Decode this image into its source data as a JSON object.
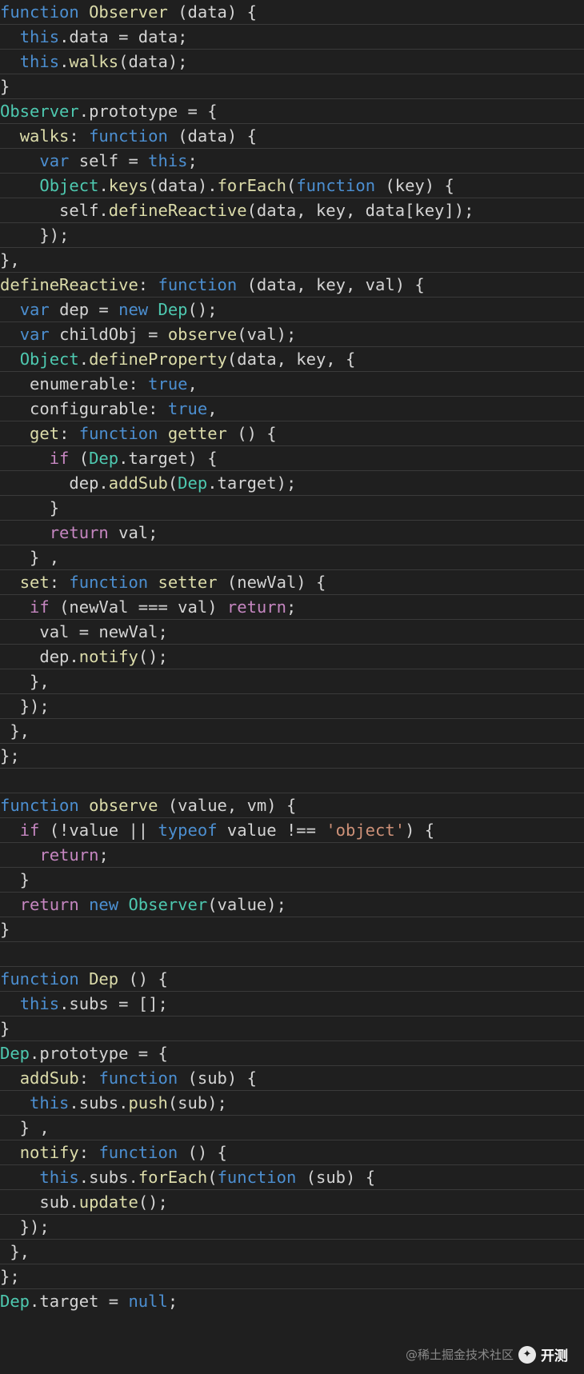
{
  "editor": {
    "colors": {
      "background": "#1f1f1f",
      "keyword": "#4c8fd1",
      "control": "#c586c0",
      "function": "#dcdcaa",
      "class": "#4ec9b0",
      "property": "#9cdcfe",
      "string": "#ce9178",
      "plain": "#d4d4d4"
    },
    "lines": [
      [
        [
          "function ",
          "kw"
        ],
        [
          "Observer ",
          "fn"
        ],
        [
          "(data) {",
          "p"
        ]
      ],
      [
        [
          "  ",
          "p"
        ],
        [
          "this",
          "kw"
        ],
        [
          ".data = data;",
          "p"
        ]
      ],
      [
        [
          "  ",
          "p"
        ],
        [
          "this",
          "kw"
        ],
        [
          ".",
          "p"
        ],
        [
          "walks",
          "fn"
        ],
        [
          "(data);",
          "p"
        ]
      ],
      [
        [
          "}",
          "p"
        ]
      ],
      [
        [
          "Observer",
          "cls"
        ],
        [
          ".prototype = {",
          "p"
        ]
      ],
      [
        [
          "  ",
          "p"
        ],
        [
          "walks",
          "fn"
        ],
        [
          ": ",
          "p"
        ],
        [
          "function ",
          "kw"
        ],
        [
          "(data) {",
          "p"
        ]
      ],
      [
        [
          "    ",
          "p"
        ],
        [
          "var ",
          "kw"
        ],
        [
          "self = ",
          "p"
        ],
        [
          "this",
          "kw"
        ],
        [
          ";",
          "p"
        ]
      ],
      [
        [
          "    ",
          "p"
        ],
        [
          "Object",
          "cls"
        ],
        [
          ".",
          "p"
        ],
        [
          "keys",
          "fn"
        ],
        [
          "(data).",
          "p"
        ],
        [
          "forEach",
          "fn"
        ],
        [
          "(",
          "p"
        ],
        [
          "function ",
          "kw"
        ],
        [
          "(key) {",
          "p"
        ]
      ],
      [
        [
          "      self.",
          "p"
        ],
        [
          "defineReactive",
          "fn"
        ],
        [
          "(data, key, data[key]);",
          "p"
        ]
      ],
      [
        [
          "    });",
          "p"
        ]
      ],
      [
        [
          "},",
          "p"
        ]
      ],
      [
        [
          "defineReactive",
          "fn"
        ],
        [
          ": ",
          "p"
        ],
        [
          "function ",
          "kw"
        ],
        [
          "(data, key, val) {",
          "p"
        ]
      ],
      [
        [
          "  ",
          "p"
        ],
        [
          "var ",
          "kw"
        ],
        [
          "dep = ",
          "p"
        ],
        [
          "new ",
          "kw"
        ],
        [
          "Dep",
          "cls"
        ],
        [
          "();",
          "p"
        ]
      ],
      [
        [
          "  ",
          "p"
        ],
        [
          "var ",
          "kw"
        ],
        [
          "childObj = ",
          "p"
        ],
        [
          "observe",
          "fn"
        ],
        [
          "(val);",
          "p"
        ]
      ],
      [
        [
          "  ",
          "p"
        ],
        [
          "Object",
          "cls"
        ],
        [
          ".",
          "p"
        ],
        [
          "defineProperty",
          "fn"
        ],
        [
          "(data, key, {",
          "p"
        ]
      ],
      [
        [
          "   enumerable: ",
          "p"
        ],
        [
          "true",
          "kw"
        ],
        [
          ",",
          "p"
        ]
      ],
      [
        [
          "   configurable: ",
          "p"
        ],
        [
          "true",
          "kw"
        ],
        [
          ",",
          "p"
        ]
      ],
      [
        [
          "   ",
          "p"
        ],
        [
          "get",
          "fn"
        ],
        [
          ": ",
          "p"
        ],
        [
          "function ",
          "kw"
        ],
        [
          "getter ",
          "fn"
        ],
        [
          "() {",
          "p"
        ]
      ],
      [
        [
          "     ",
          "p"
        ],
        [
          "if ",
          "kw2"
        ],
        [
          "(",
          "p"
        ],
        [
          "Dep",
          "cls"
        ],
        [
          ".target) {",
          "p"
        ]
      ],
      [
        [
          "       dep.",
          "p"
        ],
        [
          "addSub",
          "fn"
        ],
        [
          "(",
          "p"
        ],
        [
          "Dep",
          "cls"
        ],
        [
          ".target);",
          "p"
        ]
      ],
      [
        [
          "     }",
          "p"
        ]
      ],
      [
        [
          "     ",
          "p"
        ],
        [
          "return ",
          "kw2"
        ],
        [
          "val;",
          "p"
        ]
      ],
      [
        [
          "   } ,",
          "p"
        ]
      ],
      [
        [
          "  ",
          "p"
        ],
        [
          "set",
          "fn"
        ],
        [
          ": ",
          "p"
        ],
        [
          "function ",
          "kw"
        ],
        [
          "setter ",
          "fn"
        ],
        [
          "(newVal) {",
          "p"
        ]
      ],
      [
        [
          "   ",
          "p"
        ],
        [
          "if ",
          "kw2"
        ],
        [
          "(newVal === val) ",
          "p"
        ],
        [
          "return",
          "kw2"
        ],
        [
          ";",
          "p"
        ]
      ],
      [
        [
          "    val = newVal;",
          "p"
        ]
      ],
      [
        [
          "    dep.",
          "p"
        ],
        [
          "notify",
          "fn"
        ],
        [
          "();",
          "p"
        ]
      ],
      [
        [
          "   },",
          "p"
        ]
      ],
      [
        [
          "  });",
          "p"
        ]
      ],
      [
        [
          " },",
          "p"
        ]
      ],
      [
        [
          "};",
          "p"
        ]
      ],
      [
        [
          "",
          "p"
        ]
      ],
      [
        [
          "function ",
          "kw"
        ],
        [
          "observe ",
          "fn"
        ],
        [
          "(value, vm) {",
          "p"
        ]
      ],
      [
        [
          "  ",
          "p"
        ],
        [
          "if ",
          "kw2"
        ],
        [
          "(!value || ",
          "p"
        ],
        [
          "typeof ",
          "kw"
        ],
        [
          "value !== ",
          "p"
        ],
        [
          "'object'",
          "str"
        ],
        [
          ") {",
          "p"
        ]
      ],
      [
        [
          "    ",
          "p"
        ],
        [
          "return",
          "kw2"
        ],
        [
          ";",
          "p"
        ]
      ],
      [
        [
          "  }",
          "p"
        ]
      ],
      [
        [
          "  ",
          "p"
        ],
        [
          "return ",
          "kw2"
        ],
        [
          "new ",
          "kw"
        ],
        [
          "Observer",
          "cls"
        ],
        [
          "(value);",
          "p"
        ]
      ],
      [
        [
          "}",
          "p"
        ]
      ],
      [
        [
          "",
          "p"
        ]
      ],
      [
        [
          "function ",
          "kw"
        ],
        [
          "Dep ",
          "fn"
        ],
        [
          "() {",
          "p"
        ]
      ],
      [
        [
          "  ",
          "p"
        ],
        [
          "this",
          "kw"
        ],
        [
          ".subs = [];",
          "p"
        ]
      ],
      [
        [
          "}",
          "p"
        ]
      ],
      [
        [
          "Dep",
          "cls"
        ],
        [
          ".prototype = {",
          "p"
        ]
      ],
      [
        [
          "  ",
          "p"
        ],
        [
          "addSub",
          "fn"
        ],
        [
          ": ",
          "p"
        ],
        [
          "function ",
          "kw"
        ],
        [
          "(sub) {",
          "p"
        ]
      ],
      [
        [
          "   ",
          "p"
        ],
        [
          "this",
          "kw"
        ],
        [
          ".subs.",
          "p"
        ],
        [
          "push",
          "fn"
        ],
        [
          "(sub);",
          "p"
        ]
      ],
      [
        [
          "  } ,",
          "p"
        ]
      ],
      [
        [
          "  ",
          "p"
        ],
        [
          "notify",
          "fn"
        ],
        [
          ": ",
          "p"
        ],
        [
          "function ",
          "kw"
        ],
        [
          "() {",
          "p"
        ]
      ],
      [
        [
          "    ",
          "p"
        ],
        [
          "this",
          "kw"
        ],
        [
          ".subs.",
          "p"
        ],
        [
          "forEach",
          "fn"
        ],
        [
          "(",
          "p"
        ],
        [
          "function ",
          "kw"
        ],
        [
          "(sub) {",
          "p"
        ]
      ],
      [
        [
          "    sub.",
          "p"
        ],
        [
          "update",
          "fn"
        ],
        [
          "();",
          "p"
        ]
      ],
      [
        [
          "  });",
          "p"
        ]
      ],
      [
        [
          " },",
          "p"
        ]
      ],
      [
        [
          "};",
          "p"
        ]
      ],
      [
        [
          "Dep",
          "cls"
        ],
        [
          ".target = ",
          "p"
        ],
        [
          "null",
          "kw"
        ],
        [
          ";",
          "p"
        ]
      ]
    ]
  },
  "watermark": {
    "source": "@稀土掘金技术社区",
    "icon": "wechat-channel-icon",
    "brand": "开测"
  }
}
